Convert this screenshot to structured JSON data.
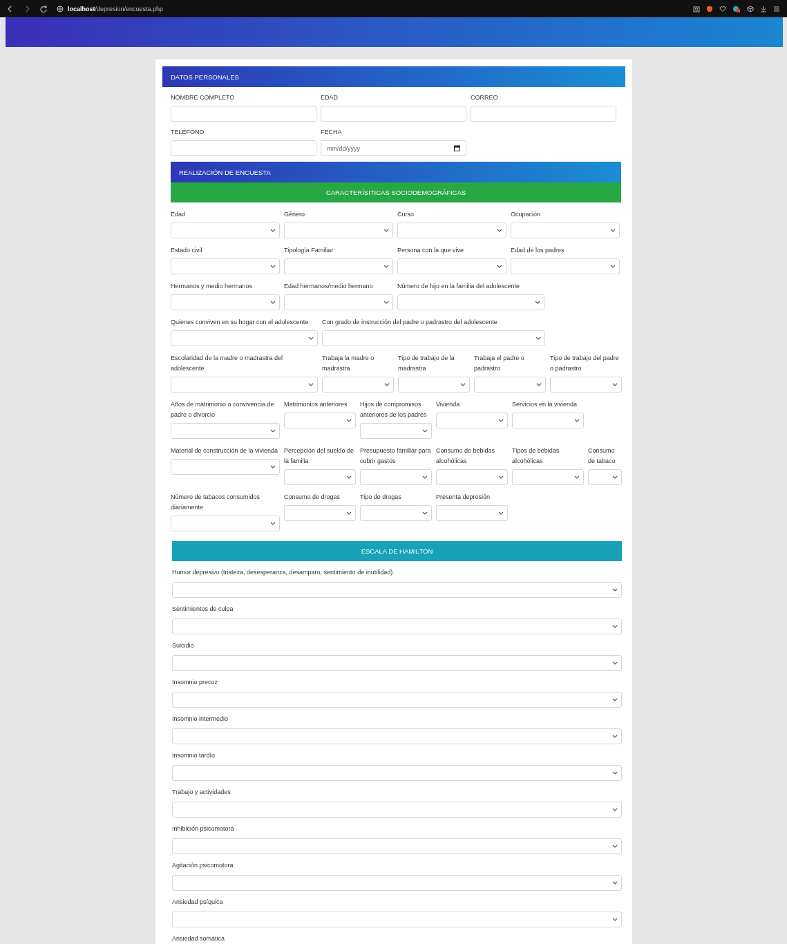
{
  "browser": {
    "url": "**localhost**/depresion/encuesta.php"
  },
  "personal": {
    "title": "DATOS PERSONALES",
    "rows": [
      [
        {
          "label": "NOMBRE COMPLETO",
          "kind": "text"
        },
        {
          "label": "EDAD",
          "kind": "text"
        },
        {
          "label": "CORREO",
          "kind": "text"
        }
      ],
      [
        {
          "label": "TELÉFONO",
          "kind": "text"
        },
        {
          "label": "FECHA",
          "kind": "date",
          "placeholder": "mm/dd/yyyy"
        }
      ]
    ]
  },
  "survey": {
    "title": "REALIZACIÓN DE ENCUESTA",
    "section": "CARACTERÍSITICAS SOCIODEMOGRÁFICAS",
    "rows": [
      [
        "Edad",
        "Género",
        "Curso",
        "Ocupación"
      ],
      [
        "Estado civil",
        "Tipología Familiar",
        "Persona con la que vive",
        "Edad de los padres"
      ],
      [
        "Hermanos y medio hermanos",
        "Edad hermanos/medio hermano",
        "Número de hijo en la familia del adolescente"
      ],
      [
        "Quienes conviven en su hogar con el adolescente",
        "Con grado de instrucción del padre o padrastro del adolescente"
      ],
      [
        "Escolaridad de la madre o madrastra del adolescente",
        "Trabaja la madre o madrastra",
        "Tipo de trabajo de la madrastra",
        "Trabaja el padre o padrastro",
        "Tipo de trabajo del padre o padrastro"
      ],
      [
        "Años de matrimonio o convivencia de padre o divorcio",
        "Matrimonios anteriores",
        "Hijos de compromisos anteriores de los padres",
        "Vivienda",
        "Servicios en la vivienda"
      ],
      [
        "Material de construcción de la vivienda",
        "Percepción del sueldo de la familia",
        "Presupuesto familiar para cubrir gastos",
        "Consumo de bebidas alcohólicas",
        "Tipos de bebidas alcohólicas",
        "Consumo de tabaco"
      ],
      [
        "Número de tabacos consumidos diariamente",
        "Consumo de drogas",
        "Tipo de drogas",
        "Presenta depresión"
      ]
    ]
  },
  "hamilton": {
    "title": "ESCALA DE HAMILTON",
    "items": [
      {
        "label": "Humor depresivo (tristeza, desesperanza, desamparo, sentimiento de inutilidad)",
        "kind": "select"
      },
      {
        "label": "Sentimientos de culpa",
        "kind": "select"
      },
      {
        "label": "Suicidio",
        "kind": "select"
      },
      {
        "label": "Insomnio precoz",
        "kind": "select"
      },
      {
        "label": "Insomnio intermedio",
        "kind": "select"
      },
      {
        "label": "Insomnio tardío",
        "kind": "select"
      },
      {
        "label": "Trabajo y actividades",
        "kind": "select"
      },
      {
        "label": "Inhibición psicomotora",
        "kind": "select"
      },
      {
        "label": "Agitación psicomotora",
        "kind": "select"
      },
      {
        "label": "Ansiedad psíquica",
        "kind": "select"
      },
      {
        "label": "Ansiedad somática",
        "kind": "label"
      }
    ]
  }
}
